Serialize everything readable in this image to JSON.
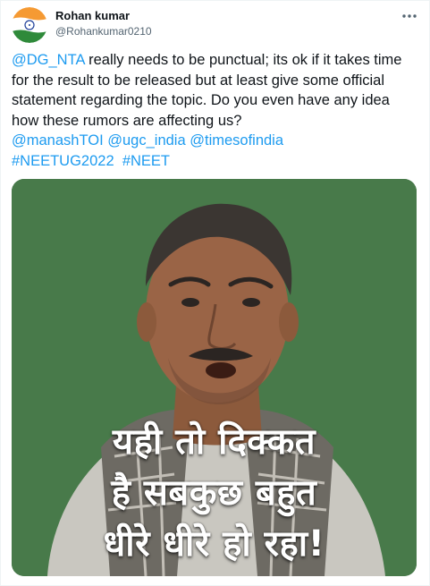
{
  "author": {
    "display_name": "Rohan kumar",
    "handle": "@Rohankumar0210",
    "avatar_icon": "india-flag-avatar"
  },
  "more_icon": "more-options-icon",
  "tweet": {
    "mention_nta": "@DG_NTA",
    "body": "  really needs to be punctual; its ok if it takes time for the result to be released but at least give some official statement regarding the topic. Do you even have any idea how these rumors are affecting us?",
    "mention_1": "@manashTOI",
    "mention_2": "@ugc_india",
    "mention_3": "@timesofindia",
    "hashtag_1": "#NEETUG2022",
    "hashtag_2": "#NEET"
  },
  "media": {
    "caption_line_1": "यही तो दिक्कत",
    "caption_line_2": "है सबकुछ बहुत",
    "caption_line_3": "धीरे धीरे हो रहा!"
  },
  "colors": {
    "link": "#1d9bf0",
    "text": "#0f1419",
    "secondary": "#536471",
    "media_background": "#487a4a"
  }
}
